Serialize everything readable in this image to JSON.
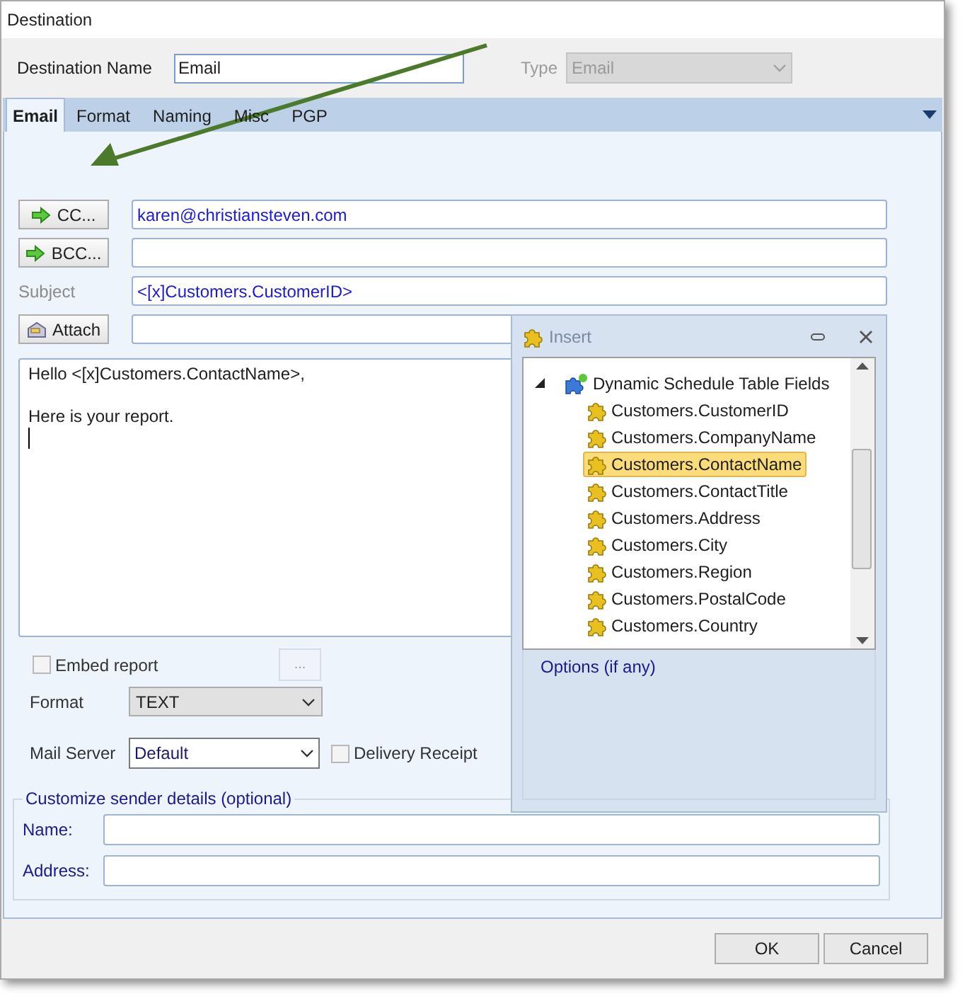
{
  "window": {
    "title": "Destination"
  },
  "destination_name": {
    "label": "Destination Name",
    "value": "Email"
  },
  "type": {
    "label": "Type",
    "value": "Email",
    "disabled": true
  },
  "tabs": [
    {
      "label": "Email",
      "selected": true
    },
    {
      "label": "Format",
      "selected": false
    },
    {
      "label": "Naming",
      "selected": false
    },
    {
      "label": "Misc",
      "selected": false
    },
    {
      "label": "PGP",
      "selected": false
    }
  ],
  "recipients": [
    {
      "kind": "address",
      "label": "CC...",
      "value": "karen@christiansteven.com"
    },
    {
      "kind": "address",
      "label": "BCC..."
    },
    {
      "kind": "label",
      "label": "Subject",
      "value": "<[x]Customers.CustomerID>"
    },
    {
      "kind": "attach",
      "label": "Attach"
    }
  ],
  "body": "Hello <[x]Customers.ContactName>,\n\nHere is your report.",
  "embed_report": {
    "label": "Embed report",
    "checked": false
  },
  "browse_button": "...",
  "format": {
    "label": "Format",
    "value": "TEXT"
  },
  "mail_server": {
    "label": "Mail Server",
    "value": "Default"
  },
  "delivery_receipt": {
    "label": "Delivery Receipt",
    "checked": false
  },
  "sender_details": {
    "legend": "Customize sender details (optional)",
    "fields": [
      {
        "label": "Name:"
      },
      {
        "label": "Address:"
      }
    ]
  },
  "buttons": [
    "OK",
    "Cancel"
  ],
  "insert_panel": {
    "title": "Insert",
    "tree": [
      {
        "label": "Dynamic Schedule Table Fields",
        "expanded": true,
        "children": [
          {
            "label": "Customers.CustomerID",
            "selected": false
          },
          {
            "label": "Customers.CompanyName",
            "selected": false
          },
          {
            "label": "Customers.ContactName",
            "selected": true
          },
          {
            "label": "Customers.ContactTitle",
            "selected": false
          },
          {
            "label": "Customers.Address",
            "selected": false
          },
          {
            "label": "Customers.City",
            "selected": false
          },
          {
            "label": "Customers.Region",
            "selected": false
          },
          {
            "label": "Customers.PostalCode",
            "selected": false
          },
          {
            "label": "Customers.Country",
            "selected": false
          }
        ]
      }
    ],
    "options_label": "Options (if any)"
  }
}
